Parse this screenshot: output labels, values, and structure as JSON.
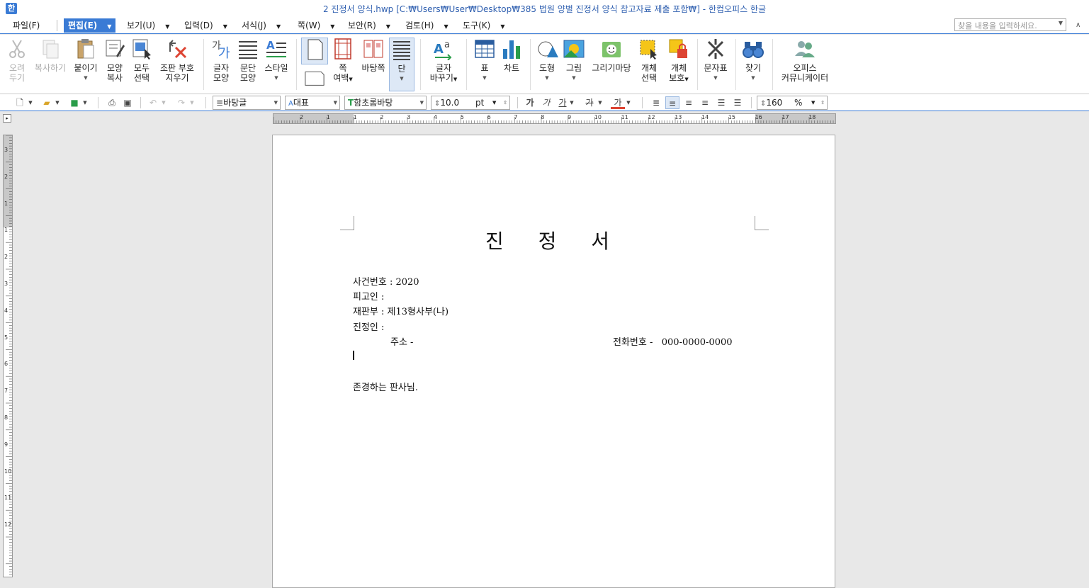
{
  "window": {
    "title": "2 진정서 양식.hwp [C:₩Users₩User₩Desktop₩385 법원 양별 진정서 양식 참고자료 제출 포함₩] - 한컴오피스 한글"
  },
  "menu": {
    "items": [
      "파일(F)",
      "편집(E)",
      "보기(U)",
      "입력(D)",
      "서식(J)",
      "쪽(W)",
      "보안(R)",
      "검토(H)",
      "도구(K)"
    ],
    "search_placeholder": "찾을 내용을 입력하세요."
  },
  "ribbon": {
    "cut": [
      "오려",
      "두기"
    ],
    "copy": "복사하기",
    "paste": "붙이기",
    "format_copy": [
      "모양",
      "복사"
    ],
    "select_all": [
      "모두",
      "선택"
    ],
    "clear_typo": [
      "조판 부호",
      "지우기"
    ],
    "char_shape": [
      "글자",
      "모양"
    ],
    "para_shape": [
      "문단",
      "모양"
    ],
    "style": "스타일",
    "page_margin": [
      "쪽",
      "여백"
    ],
    "master_page": "바탕쪽",
    "column": "단",
    "char_replace": [
      "글자",
      "바꾸기"
    ],
    "table": "표",
    "chart": "차트",
    "shape": "도형",
    "picture": "그림",
    "draw_yard": "그리기마당",
    "object_select": [
      "개체",
      "선택"
    ],
    "object_protect": [
      "개체",
      "보호"
    ],
    "char_map": "문자표",
    "find": "찾기",
    "communicator": [
      "오피스",
      "커뮤니케이터"
    ]
  },
  "format_bar": {
    "style": "바탕글",
    "lang": "대표",
    "font": "함초롬바탕",
    "size": "10.0",
    "size_unit": "pt",
    "bold": "가",
    "italic": "가",
    "underline": "가",
    "strike": "가",
    "color": "가",
    "zoom": "160",
    "zoom_unit": "%"
  },
  "ruler": {
    "h_numbers": [
      "2",
      "1",
      "1",
      "2",
      "3",
      "4",
      "5",
      "6",
      "7",
      "8",
      "9",
      "10",
      "11",
      "12",
      "13",
      "14",
      "15",
      "16",
      "17",
      "18"
    ],
    "v_numbers": [
      "3",
      "2",
      "1",
      "1",
      "2",
      "3",
      "4",
      "5",
      "6",
      "7",
      "8",
      "9",
      "10",
      "11",
      "12"
    ]
  },
  "document": {
    "title": "진 정 서",
    "case_no": "사건번호 : 2020",
    "defendant": "피고인 :",
    "court": "재판부 : 제13형사부(나)",
    "petitioner": "진정인 :",
    "address": "주소 -",
    "phone": "전화번호 -   000-0000-0000",
    "greeting": "존경하는 판사님."
  }
}
